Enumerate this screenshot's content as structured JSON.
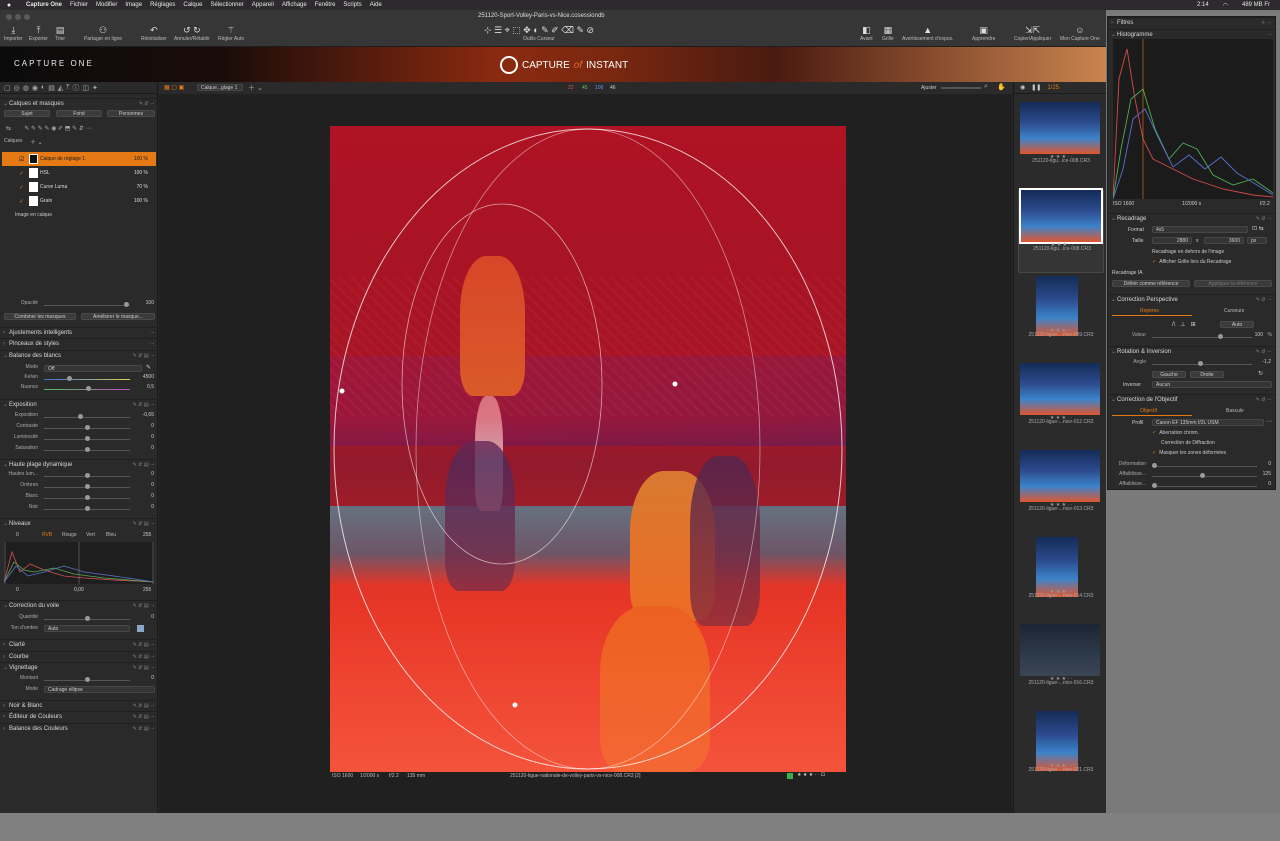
{
  "menubar": {
    "app": "Capture One",
    "items": [
      "Fichier",
      "Modifier",
      "Image",
      "Réglages",
      "Calque",
      "Sélectionner",
      "Appareil",
      "Affichage",
      "Fenêtre",
      "Scripts",
      "Aide"
    ],
    "time": "2:14",
    "memory": "489 MB Fr"
  },
  "window": {
    "title": "251120-Sport-Volley-Paris-vs-Nice.cosessiondb"
  },
  "toolbar": {
    "left": [
      "Importer",
      "Exporter",
      "Trier",
      "Partager en ligne",
      "Réinitialiser",
      "Annuler/Rétablir",
      "Régler Auto"
    ],
    "center": "Outils Curseur",
    "right": [
      "Avant",
      "Grille",
      "Avertissement d'expos.",
      "Apprendre",
      "Copier/Appliquer",
      "Mon Capture One"
    ]
  },
  "brand": {
    "left": "CAPTURE ONE",
    "center_a": "CAPTURE",
    "center_b": "of",
    "center_c": "INSTANT"
  },
  "left_panel": {
    "layers_section": "Calques et masques",
    "buttons": [
      "Sujet",
      "Fond",
      "Personnes"
    ],
    "layers_label": "Calques",
    "layers": [
      {
        "name": "Calque de réglage 1",
        "opacity": "100 %",
        "active": true
      },
      {
        "name": "HSL",
        "opacity": "100 %"
      },
      {
        "name": "Curve Luma",
        "opacity": "70 %"
      },
      {
        "name": "Grain",
        "opacity": "100 %"
      }
    ],
    "image_layer": "Image en calque",
    "opacity_label": "Opacité",
    "opacity_value": "100",
    "combine": "Combiner les masques",
    "improve": "Améliorer le masque...",
    "sections_top": [
      "Ajustements intelligents",
      "Pinceaux de styles"
    ],
    "wb": {
      "title": "Balance des blancs",
      "mode_label": "Mode",
      "mode_value": "Off",
      "kelvin_label": "Kelvin",
      "kelvin": "4500",
      "tint_label": "Nuance",
      "tint": "0,5"
    },
    "exposure": {
      "title": "Exposition",
      "rows": [
        {
          "label": "Exposition",
          "value": "-0,65",
          "pos": 0.4
        },
        {
          "label": "Contraste",
          "value": "0",
          "pos": 0.5
        },
        {
          "label": "Luminosité",
          "value": "0",
          "pos": 0.5
        },
        {
          "label": "Saturation",
          "value": "0",
          "pos": 0.5
        }
      ]
    },
    "hdr": {
      "title": "Haute plage dynamique",
      "rows": [
        {
          "label": "Hautes lum...",
          "value": "0",
          "pos": 0.5
        },
        {
          "label": "Ombres",
          "value": "0",
          "pos": 0.5
        },
        {
          "label": "Blanc",
          "value": "0",
          "pos": 0.5
        },
        {
          "label": "Noir",
          "value": "0",
          "pos": 0.5
        }
      ]
    },
    "levels": {
      "title": "Niveaux",
      "min": "0",
      "max": "255",
      "tabs": [
        "RVB",
        "Rouge",
        "Vert",
        "Bleu"
      ],
      "out_min": "0",
      "out_mid": "0,00",
      "out_max": "255"
    },
    "haze": {
      "title": "Correction du voile",
      "q_label": "Quantité",
      "q_value": "0",
      "tone_label": "Ton d'ombre",
      "tone_value": "Auto"
    },
    "clarity": "Clarté",
    "curve": "Courbe",
    "vignette": {
      "title": "Vignettage",
      "amount_label": "Montant",
      "amount": "0",
      "mode_label": "Mode",
      "mode": "Cadrage ellipse"
    },
    "sections_bottom": [
      "Noir & Blanc",
      "Éditeur de Couleurs",
      "Balance des Couleurs"
    ]
  },
  "viewer": {
    "layer_select": "Calque...glage 1",
    "counts": [
      "22",
      "45",
      "108",
      "46"
    ],
    "adjust": "Ajuster",
    "page": "1/25",
    "footer_left": [
      "ISO 1600",
      "1/2000 s",
      "f/2.2",
      "135 mm"
    ],
    "footer_file": "251120-ligue-nationale-de-volley-paris-vs-nice-008.CR3 [2]"
  },
  "filmstrip": [
    {
      "name": "251120-ligu...ice-008.CR3",
      "stars": "★ ★ ★ · ·",
      "kind": "land"
    },
    {
      "name": "251120-ligu...ice-008.CR3",
      "stars": "★ ★ ★ · ·",
      "kind": "land",
      "selected": true
    },
    {
      "name": "251120-ligue-...nice-009.CR3",
      "stars": "★ ★ ★ · ·",
      "kind": "portrait"
    },
    {
      "name": "251120-ligue-...nice-012.CR3",
      "stars": "★ ★ ★ · ·",
      "kind": "land"
    },
    {
      "name": "251120-ligue-...nice-013.CR3",
      "stars": "★ ★ ★ · ·",
      "kind": "land"
    },
    {
      "name": "251120-ligue-...nice-014.CR3",
      "stars": "★ ★ ★ · ·",
      "kind": "portrait"
    },
    {
      "name": "251120-ligue-...nice-016.CR3",
      "stars": "★ ★ ★ · ·",
      "kind": "dark"
    },
    {
      "name": "251120-ligue-...nice-021.CR3",
      "stars": "★ ★ ★ · ·",
      "kind": "portrait"
    }
  ],
  "right_panel": {
    "filters": "Filtres",
    "histogram": "Histogramme",
    "hist_iso": "ISO 1600",
    "hist_speed": "1/2000 s",
    "hist_f": "f/2.2",
    "crop": {
      "title": "Recadrage",
      "format_label": "Format",
      "format": "4x5",
      "size_label": "Taille",
      "w": "2880",
      "x": "x",
      "h": "3600",
      "unit": "px",
      "outside": "Recadrage en dehors de l'image",
      "grid": "Afficher Grille lors du Recadrage",
      "ai": "Recadrage IA",
      "define": "Définir comme référence",
      "apply": "Appliquer la référence"
    },
    "perspective": {
      "title": "Correction Perspective",
      "tab1": "Repères",
      "tab2": "Curseurs",
      "auto": "Auto",
      "value_label": "Valeur",
      "value": "100",
      "pct": "%"
    },
    "rotation": {
      "title": "Rotation & Inversion",
      "angle_label": "Angle",
      "angle": "-1,2",
      "left": "Gauche",
      "right": "Droite",
      "invert_label": "Inverser",
      "invert": "Aucun"
    },
    "lens": {
      "title": "Correction de l'Objectif",
      "tab1": "Objectif",
      "tab2": "Bascule",
      "profile_label": "Profil",
      "profile": "Canon EF 135mm f/2L USM",
      "chroma": "Aberration chrom.",
      "diffraction": "Correction de Diffraction",
      "mask": "Masquer les zones déformées",
      "rows": [
        {
          "label": "Déformation",
          "value": "0",
          "pos": 0.0
        },
        {
          "label": "Affaiblisse...",
          "value": "125",
          "pos": 0.48
        },
        {
          "label": "Affaiblisse...",
          "value": "0",
          "pos": 0.0
        }
      ]
    }
  }
}
